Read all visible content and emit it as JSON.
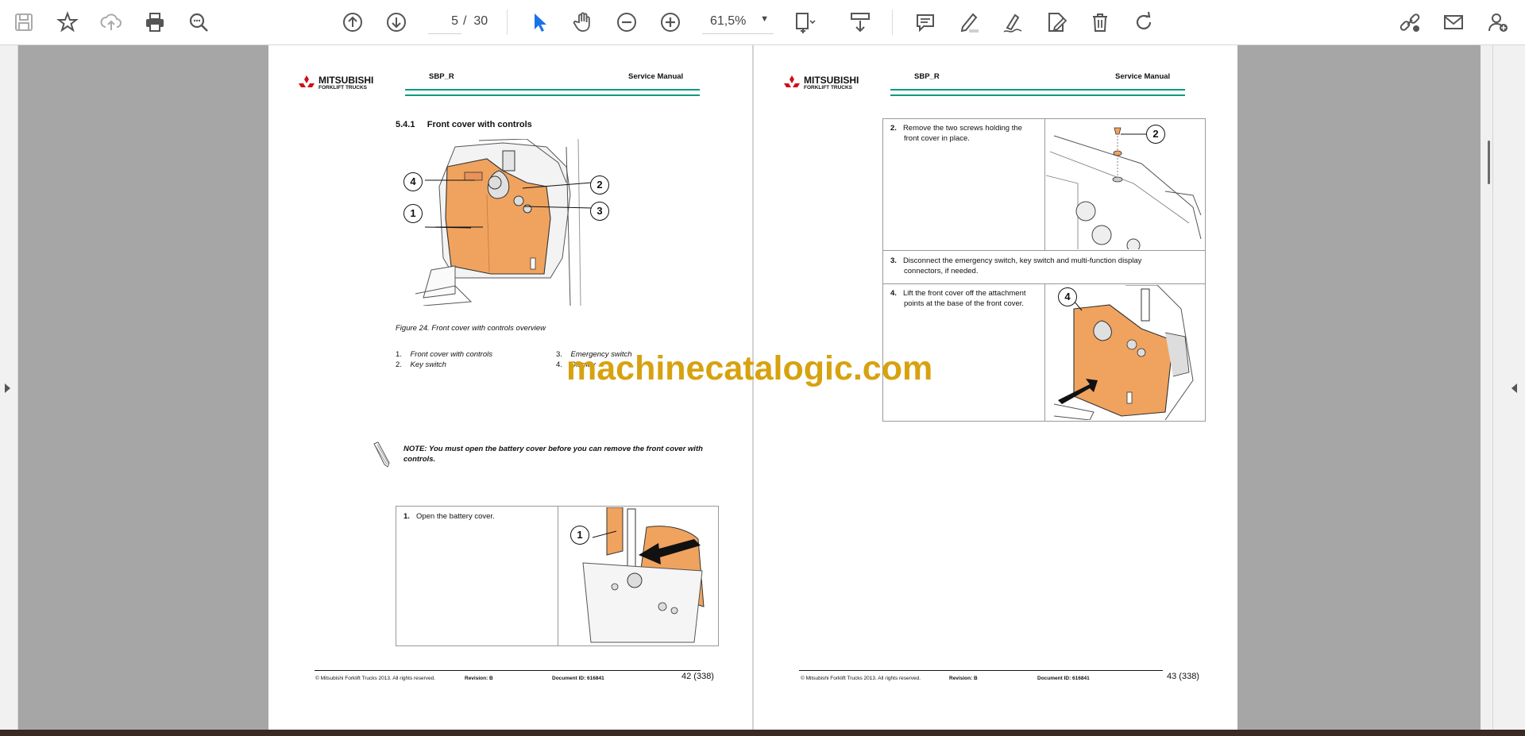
{
  "toolbar": {
    "page_current": "5",
    "page_sep": "/",
    "page_total": "30",
    "zoom_value": "61,5%",
    "icons": [
      "save-icon",
      "bookmark-star-icon",
      "upload-cloud-icon",
      "print-icon",
      "zoom-search-icon",
      "page-up-icon",
      "page-down-icon",
      "zoom-out-icon",
      "zoom-in-icon",
      "select-cursor-icon",
      "hand-icon",
      "fit-page-icon",
      "scroll-mode-icon",
      "comment-icon",
      "highlight-pen-icon",
      "draw-icon",
      "edit-doc-icon",
      "delete-icon",
      "rotate-icon",
      "share-link-icon",
      "email-icon",
      "add-user-icon"
    ]
  },
  "left_page": {
    "logo_top": "MITSUBISHI",
    "logo_bottom": "FORKLIFT TRUCKS",
    "header_model": "SBP_R",
    "header_title": "Service Manual",
    "section_title": "5.4.1     Front cover with controls",
    "callouts": [
      "1",
      "2",
      "3",
      "4"
    ],
    "figure_caption": "Figure 24. Front cover with controls overview",
    "legend": [
      {
        "num": "1.",
        "text": "Front cover with controls"
      },
      {
        "num": "2.",
        "text": "Key switch"
      },
      {
        "num": "3.",
        "text": "Emergency switch"
      },
      {
        "num": "4.",
        "text": "Display"
      }
    ],
    "note_line1": "NOTE: You must open the battery cover before you can remove the front cover with",
    "note_line2": "controls.",
    "step1_num": "1.",
    "step1_text": "Open the battery cover.",
    "step1_callout": "1",
    "footer_copyright": "© Mitsubishi Forklift Trucks 2013. All rights reserved.",
    "footer_revision": "Revision: B",
    "footer_docid": "Document ID: 616841",
    "footer_page": "42 (338)"
  },
  "right_page": {
    "logo_top": "MITSUBISHI",
    "logo_bottom": "FORKLIFT TRUCKS",
    "header_model": "SBP_R",
    "header_title": "Service Manual",
    "step2_num": "2.",
    "step2_line1": "Remove the two screws holding the",
    "step2_line2": "front cover in place.",
    "step2_callout": "2",
    "step3_num": "3.",
    "step3_line1": "Disconnect the emergency switch, key switch and multi-function display",
    "step3_line2": "connectors, if needed.",
    "step4_num": "4.",
    "step4_line1": "Lift the front cover off the attachment",
    "step4_line2": "points at the base of the front cover.",
    "step4_callout": "4",
    "footer_copyright": "© Mitsubishi Forklift Trucks 2013. All rights reserved.",
    "footer_revision": "Revision: B",
    "footer_docid": "Document ID: 616841",
    "footer_page": "43 (338)"
  },
  "watermark": "machinecatalogic.com",
  "colors": {
    "accent_blue": "#1a73e8",
    "header_green": "#109a82",
    "cover_orange": "#f0a35e",
    "logo_red": "#d0101a",
    "viewer_gray": "#a6a6a6"
  }
}
